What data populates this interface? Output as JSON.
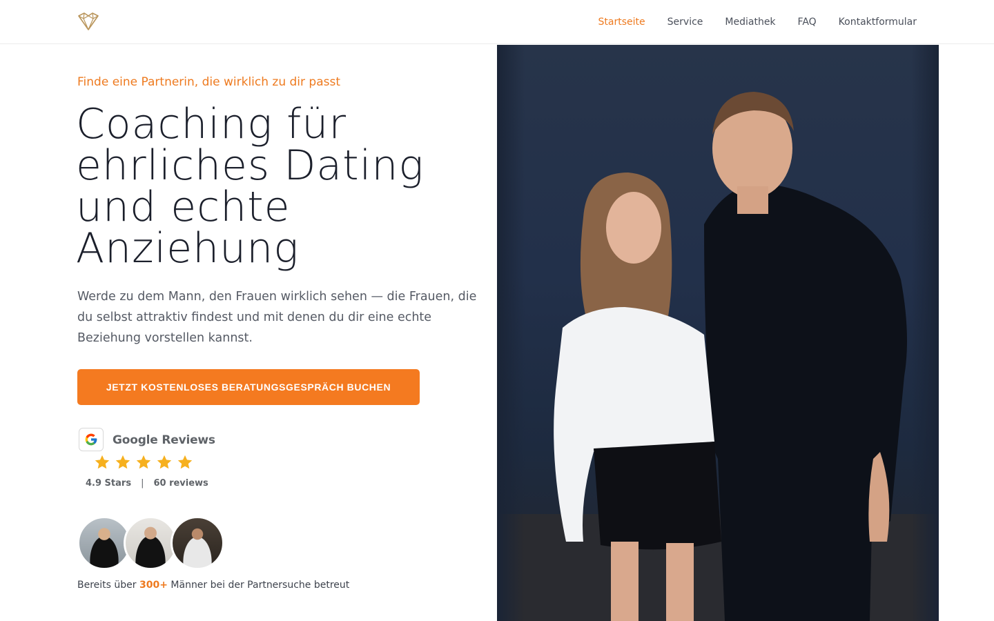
{
  "header": {
    "logo_name": "diamond-logo",
    "nav": [
      {
        "label": "Startseite",
        "active": true
      },
      {
        "label": "Service",
        "active": false
      },
      {
        "label": "Mediathek",
        "active": false
      },
      {
        "label": "FAQ",
        "active": false
      },
      {
        "label": "Kontaktformular",
        "active": false
      }
    ]
  },
  "hero": {
    "eyebrow": "Finde eine Partnerin, die wirklich zu dir passt",
    "headline_lines": [
      "Coaching für",
      "ehrliches Dating",
      "und echte",
      "Anziehung"
    ],
    "lead": "Werde zu dem Mann, den Frauen wirklich sehen — die Frauen, die du selbst attraktiv findest und mit denen du dir eine echte Beziehung vorstellen kannst.",
    "cta_label": "JETZT KOSTENLOSES BERATUNGSGESPRÄCH BUCHEN"
  },
  "reviews": {
    "title": "Google Reviews",
    "stars": 5,
    "rating_text": "4.9 Stars",
    "separator": "|",
    "count_text": "60 reviews"
  },
  "social_proof": {
    "prefix": "Bereits über",
    "highlight": "300+",
    "suffix": "Männer bei der Partnersuche betreut"
  },
  "colors": {
    "accent": "#f47a20",
    "star": "#f6b01e",
    "text_dark": "#1b1f2b",
    "text_muted": "#555a64"
  }
}
